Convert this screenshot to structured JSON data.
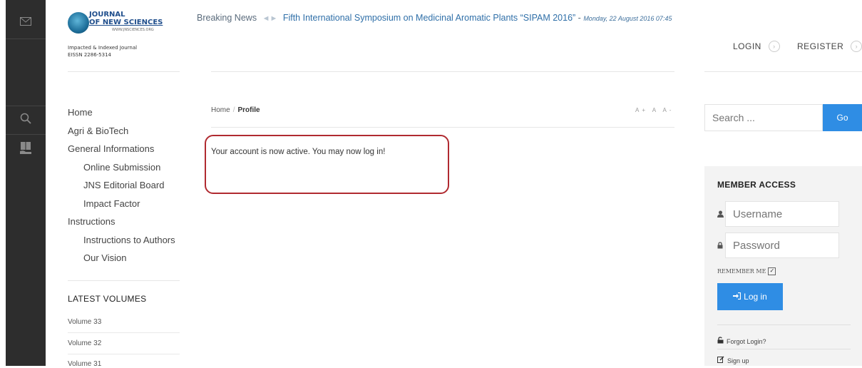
{
  "logo": {
    "line1": "JOURNAL",
    "line2": "OF NEW SCIENCES",
    "line3": "WWW.JNSCIENCES.ORG",
    "tagline1": "Impacted & Indexed Journal",
    "tagline2": "EISSN 2286-5314"
  },
  "breaking": {
    "label": "Breaking News",
    "arrows": "◄►",
    "headline": "Fifth International Symposium on Medicinal Aromatic Plants “SIPAM 2016”",
    "separator": " - ",
    "date": "Monday, 22 August 2016 07:45"
  },
  "auth": {
    "login": "LOGIN",
    "register": "REGISTER",
    "arrow": "›"
  },
  "nav": {
    "home": "Home",
    "agri": "Agri & BioTech",
    "general": "General Informations",
    "online_submission": "Online Submission",
    "editorial_board": "JNS Editorial Board",
    "impact_factor": "Impact Factor",
    "instructions": "Instructions",
    "instructions_authors": "Instructions to Authors",
    "our_vision": "Our Vision"
  },
  "latest": {
    "title": "LATEST VOLUMES",
    "volumes": [
      "Volume 33",
      "Volume 32",
      "Volume 31"
    ]
  },
  "breadcrumb": {
    "home": "Home",
    "sep": "/",
    "current": "Profile"
  },
  "font_controls": "A+ A A-",
  "message": "Your account is now active. You may now log in!",
  "search": {
    "placeholder": "Search ...",
    "button": "Go"
  },
  "member": {
    "title": "MEMBER ACCESS",
    "username_placeholder": "Username",
    "password_placeholder": "Password",
    "remember": "REMEMBER ME",
    "checkmark": "✓",
    "login_button": "Log in",
    "forgot": "Forgot Login?",
    "signup": "Sign up"
  }
}
